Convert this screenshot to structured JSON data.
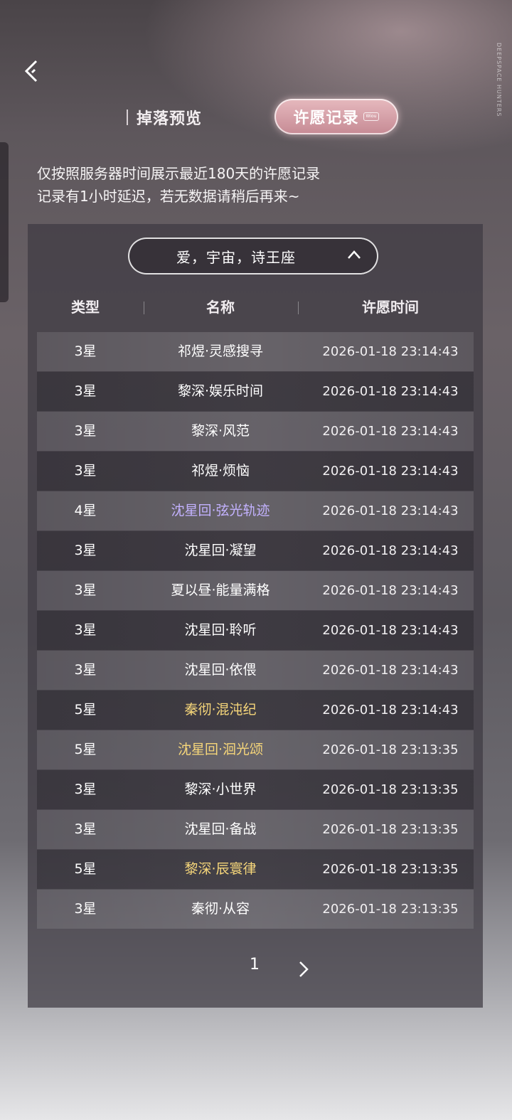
{
  "brand": {
    "side_text": "DEEPSPACE HUNTERS"
  },
  "tabs": {
    "drop_preview": "掉落预览",
    "wish_record": "许愿记录",
    "wish_badge": "Wiou"
  },
  "notice": {
    "line1": "仅按照服务器时间展示最近180天的许愿记录",
    "line2": "记录有1小时延迟，若无数据请稍后再来~"
  },
  "filter": {
    "selected": "爱，宇宙，诗王座"
  },
  "table": {
    "headers": {
      "type": "类型",
      "name": "名称",
      "time": "许愿时间"
    },
    "rows": [
      {
        "type": "3星",
        "name": "祁煜·灵感搜寻",
        "time": "2026-01-18 23:14:43",
        "rarity": 3
      },
      {
        "type": "3星",
        "name": "黎深·娱乐时间",
        "time": "2026-01-18 23:14:43",
        "rarity": 3
      },
      {
        "type": "3星",
        "name": "黎深·风范",
        "time": "2026-01-18 23:14:43",
        "rarity": 3
      },
      {
        "type": "3星",
        "name": "祁煜·烦恼",
        "time": "2026-01-18 23:14:43",
        "rarity": 3
      },
      {
        "type": "4星",
        "name": "沈星回·弦光轨迹",
        "time": "2026-01-18 23:14:43",
        "rarity": 4
      },
      {
        "type": "3星",
        "name": "沈星回·凝望",
        "time": "2026-01-18 23:14:43",
        "rarity": 3
      },
      {
        "type": "3星",
        "name": "夏以昼·能量满格",
        "time": "2026-01-18 23:14:43",
        "rarity": 3
      },
      {
        "type": "3星",
        "name": "沈星回·聆听",
        "time": "2026-01-18 23:14:43",
        "rarity": 3
      },
      {
        "type": "3星",
        "name": "沈星回·依偎",
        "time": "2026-01-18 23:14:43",
        "rarity": 3
      },
      {
        "type": "5星",
        "name": "秦彻·混沌纪",
        "time": "2026-01-18 23:14:43",
        "rarity": 5
      },
      {
        "type": "5星",
        "name": "沈星回·洄光颂",
        "time": "2026-01-18 23:13:35",
        "rarity": 5
      },
      {
        "type": "3星",
        "name": "黎深·小世界",
        "time": "2026-01-18 23:13:35",
        "rarity": 3
      },
      {
        "type": "3星",
        "name": "沈星回·备战",
        "time": "2026-01-18 23:13:35",
        "rarity": 3
      },
      {
        "type": "5星",
        "name": "黎深·辰寰律",
        "time": "2026-01-18 23:13:35",
        "rarity": 5
      },
      {
        "type": "3星",
        "name": "秦彻·从容",
        "time": "2026-01-18 23:13:35",
        "rarity": 3
      }
    ]
  },
  "pager": {
    "current": "1"
  },
  "colors": {
    "four_star": "#c3b2ff",
    "five_star": "#f6d67a",
    "tab_active": "#d59aa3"
  }
}
